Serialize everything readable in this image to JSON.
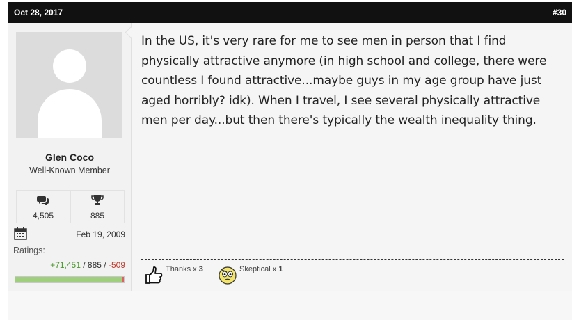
{
  "post": {
    "date": "Oct 28, 2017",
    "number": "#30",
    "message": "In the US, it's very rare for me to see men in person that I find physically attractive anymore (in high school and college, there were countless I found attractive...maybe guys in my age group have just aged horribly? idk). When I travel, I see several physically attractive men per day...but then there's typically the wealth inequality thing."
  },
  "user": {
    "name": "Glen Coco",
    "title": "Well-Known Member",
    "avatar_icon": "default-avatar-icon",
    "messages": "4,505",
    "messages_icon": "speech-bubbles-icon",
    "trophies": "885",
    "trophies_icon": "trophy-icon",
    "joined_icon": "calendar-icon",
    "joined": "Feb 19, 2009",
    "ratings_label": "Ratings:",
    "ratings_positive": "+71,451",
    "ratings_sep1": " / ",
    "ratings_neutral": "885",
    "ratings_sep2": " / ",
    "ratings_negative": "-509",
    "ratings_bar_positive_fraction": 0.98
  },
  "reactions": [
    {
      "icon": "thumbs-up-icon",
      "label": "Thanks",
      "times": " x ",
      "count": "3"
    },
    {
      "icon": "skeptical-face-icon",
      "label": "Skeptical",
      "times": " x ",
      "count": "1"
    }
  ],
  "colors": {
    "header_bg": "#111111",
    "positive": "#4a9a2a",
    "negative": "#c0392b",
    "bar_fill": "#9fce7d"
  }
}
